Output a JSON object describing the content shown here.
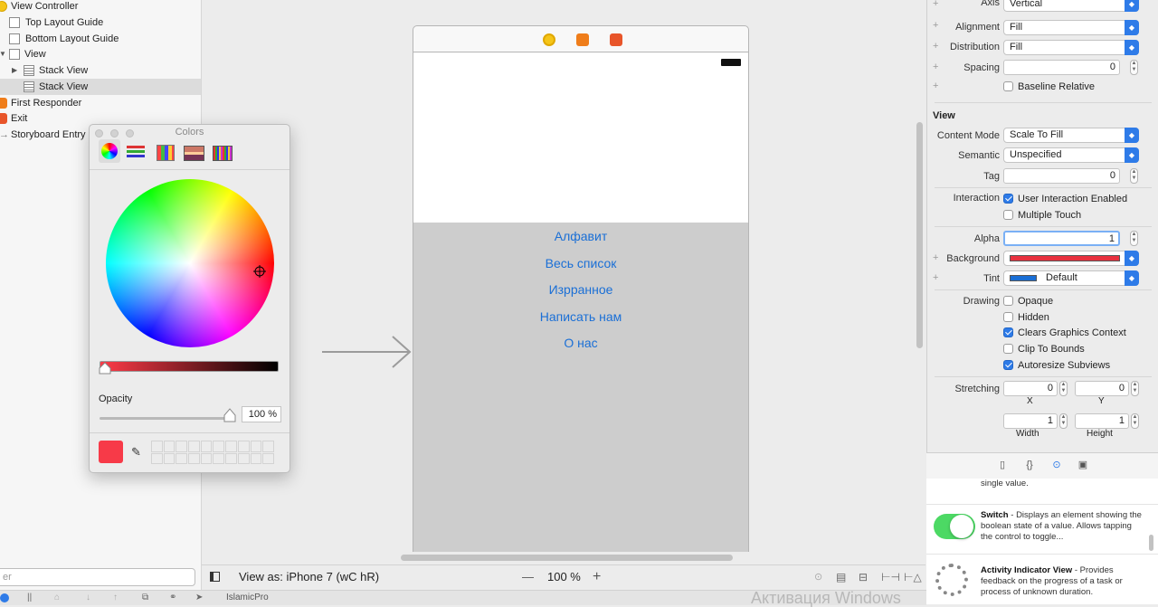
{
  "navigator": {
    "items": [
      {
        "label": "View Controller",
        "icon": "view-controller-icon"
      },
      {
        "label": "Top Layout Guide",
        "icon": "layout-guide-icon"
      },
      {
        "label": "Bottom Layout Guide",
        "icon": "layout-guide-icon"
      },
      {
        "label": "View",
        "icon": "view-icon"
      },
      {
        "label": "Stack View",
        "icon": "stack-view-icon"
      },
      {
        "label": "Stack View",
        "icon": "stack-view-icon"
      },
      {
        "label": "First Responder",
        "icon": "first-responder-icon"
      },
      {
        "label": "Exit",
        "icon": "exit-icon"
      },
      {
        "label": "Storyboard Entry Point",
        "icon": "arrow-icon"
      }
    ],
    "filter_text": "er"
  },
  "canvas": {
    "buttons": [
      "Алфавит",
      "Весь список",
      "Изрранное",
      "Написать нам",
      "О нас"
    ]
  },
  "bottombar": {
    "view_as": "View as: iPhone 7 (wC hR)",
    "zoom_minus": "—",
    "zoom": "100 %",
    "zoom_plus": "+"
  },
  "footer": {
    "scheme": "IslamicPro",
    "watermark": "Активация Windows"
  },
  "colors_panel": {
    "title": "Colors",
    "opacity_label": "Opacity",
    "opacity_value": "100 %",
    "current_color": "#f73a48"
  },
  "inspector": {
    "stack": {
      "axis_label": "Axis",
      "axis_value": "Vertical",
      "alignment_label": "Alignment",
      "alignment_value": "Fill",
      "distribution_label": "Distribution",
      "distribution_value": "Fill",
      "spacing_label": "Spacing",
      "spacing_value": "0",
      "baseline_label": "Baseline Relative"
    },
    "view": {
      "section": "View",
      "content_mode_label": "Content Mode",
      "content_mode_value": "Scale To Fill",
      "semantic_label": "Semantic",
      "semantic_value": "Unspecified",
      "tag_label": "Tag",
      "tag_value": "0",
      "interaction_label": "Interaction",
      "user_interaction": "User Interaction Enabled",
      "multiple_touch": "Multiple Touch",
      "alpha_label": "Alpha",
      "alpha_value": "1",
      "background_label": "Background",
      "tint_label": "Tint",
      "tint_value": "Default",
      "drawing_label": "Drawing",
      "opaque": "Opaque",
      "hidden": "Hidden",
      "clears": "Clears Graphics Context",
      "clip": "Clip To Bounds",
      "autoresize": "Autoresize Subviews",
      "stretching_label": "Stretching",
      "stretch_x": "0",
      "stretch_y": "0",
      "x_label": "X",
      "y_label": "Y",
      "stretch_w": "1",
      "stretch_h": "1",
      "w_label": "Width",
      "h_label": "Height"
    },
    "colors": {
      "background": "#e8313f",
      "tint": "#1a6fd6",
      "accent": "#2e7be8"
    }
  },
  "library": {
    "items": [
      {
        "title": "",
        "desc": "single value."
      },
      {
        "title": "Switch",
        "desc": " - Displays an element showing the boolean state of a value. Allows tapping the control to toggle..."
      },
      {
        "title": "Activity Indicator View",
        "desc": " - Provides feedback on the progress of a task or process of unknown duration."
      }
    ]
  }
}
